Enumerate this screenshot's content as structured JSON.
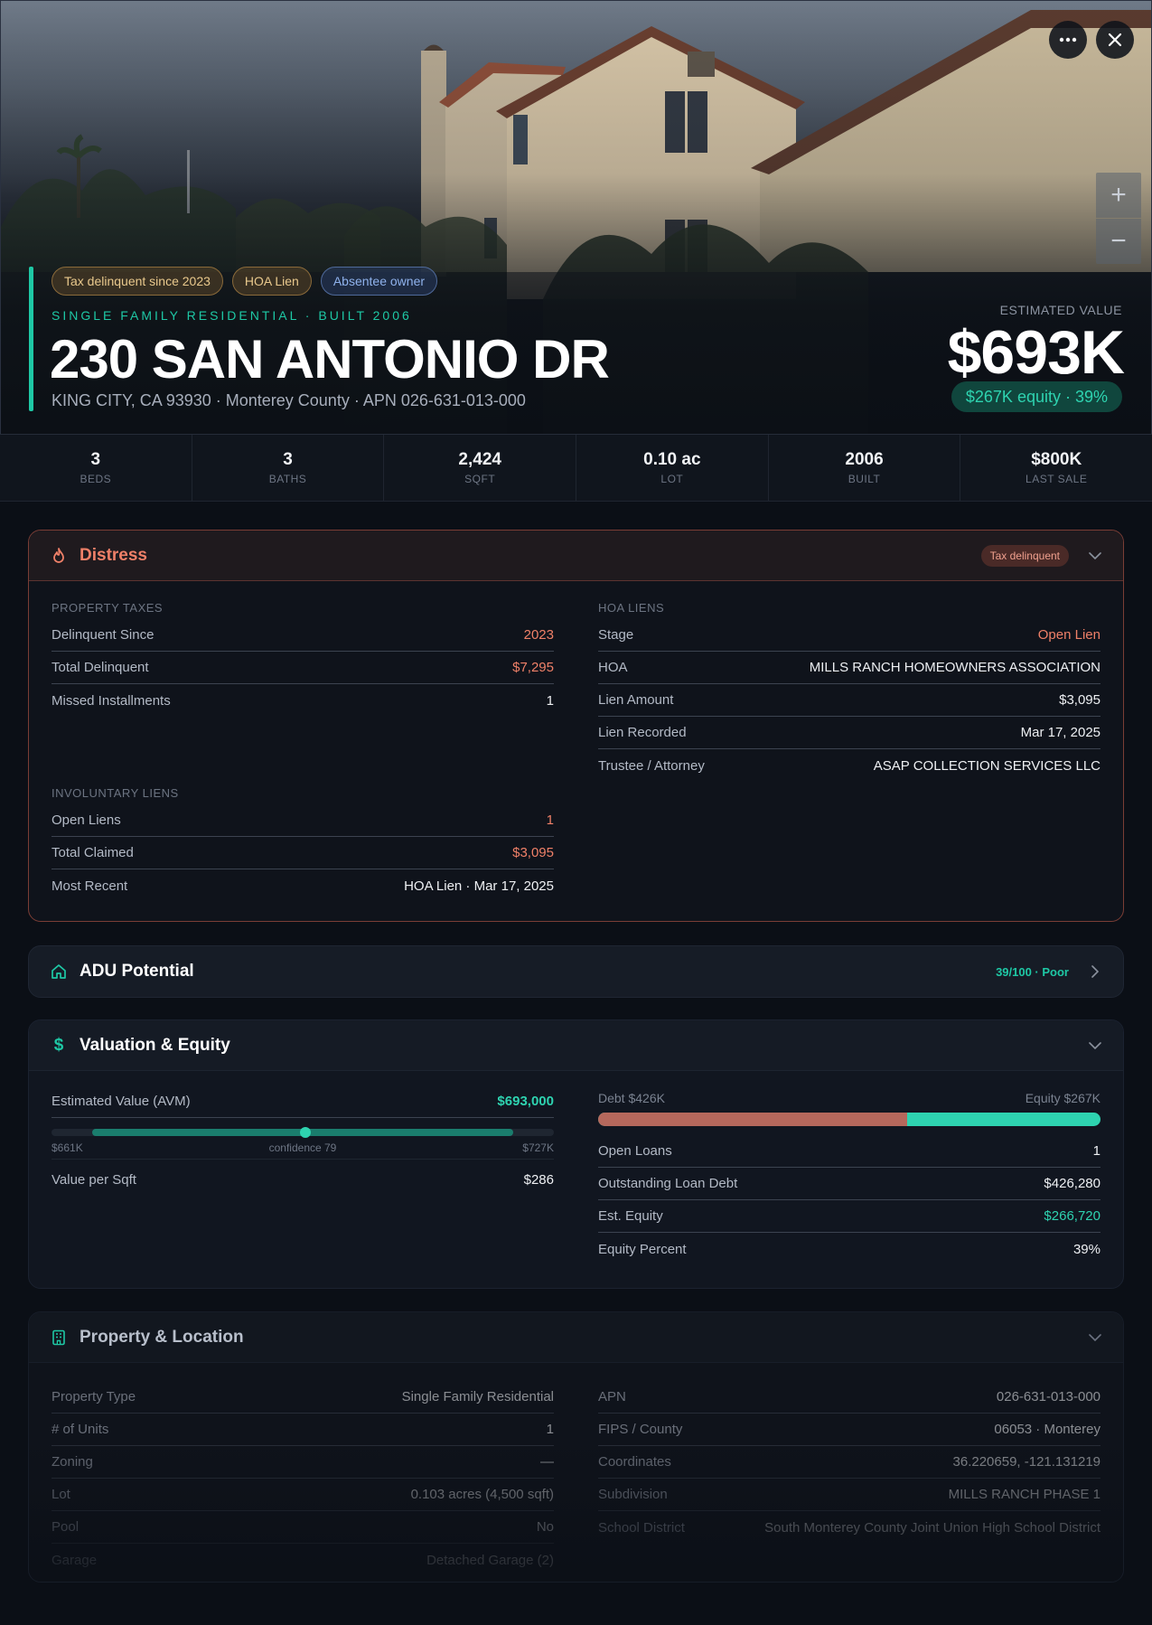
{
  "hero": {
    "tags": {
      "tax": "Tax delinquent since 2023",
      "hoa": "HOA Lien",
      "absentee": "Absentee owner"
    },
    "subtype": "SINGLE FAMILY RESIDENTIAL · BUILT 2006",
    "address": "230 SAN ANTONIO DR",
    "location": "KING CITY, CA 93930 · Monterey County · APN 026-631-013-000",
    "estimated_label": "ESTIMATED VALUE",
    "estimated_value": "$693K",
    "equity_pill": "$267K equity · 39%",
    "zoom_in": "+",
    "zoom_out": "−"
  },
  "stats": [
    {
      "value": "3",
      "label": "BEDS"
    },
    {
      "value": "3",
      "label": "BATHS"
    },
    {
      "value": "2,424",
      "label": "SQFT"
    },
    {
      "value": "0.10 ac",
      "label": "LOT"
    },
    {
      "value": "2006",
      "label": "BUILT"
    },
    {
      "value": "$800K",
      "label": "LAST SALE"
    }
  ],
  "distress": {
    "title": "Distress",
    "badge": "Tax delinquent",
    "property_taxes": {
      "label": "PROPERTY TAXES",
      "rows": [
        {
          "k": "Delinquent Since",
          "v": "2023"
        },
        {
          "k": "Total Delinquent",
          "v": "$7,295"
        },
        {
          "k": "Missed Installments",
          "v": "1"
        }
      ]
    },
    "involuntary_liens": {
      "label": "INVOLUNTARY LIENS",
      "rows": [
        {
          "k": "Open Liens",
          "v": "1"
        },
        {
          "k": "Total Claimed",
          "v": "$3,095"
        },
        {
          "k": "Most Recent",
          "v": "HOA Lien · Mar 17, 2025"
        }
      ]
    },
    "hoa_liens": {
      "label": "HOA LIENS",
      "rows": [
        {
          "k": "Stage",
          "v": "Open Lien"
        },
        {
          "k": "HOA",
          "v": "MILLS RANCH HOMEOWNERS ASSOCIATION"
        },
        {
          "k": "Lien Amount",
          "v": "$3,095"
        },
        {
          "k": "Lien Recorded",
          "v": "Mar 17, 2025"
        },
        {
          "k": "Trustee / Attorney",
          "v": "ASAP COLLECTION SERVICES LLC"
        }
      ]
    }
  },
  "adu": {
    "title": "ADU Potential",
    "score": "39/100 · Poor"
  },
  "valuation": {
    "title": "Valuation & Equity",
    "avm_label": "Estimated Value (AVM)",
    "avm_value": "$693,000",
    "avm_low": "$661K",
    "avm_confidence": "confidence 79",
    "avm_high": "$727K",
    "value_per_sqft_label": "Value per Sqft",
    "value_per_sqft": "$286",
    "debt_label": "Debt $426K",
    "equity_label": "Equity $267K",
    "debt_fraction": 0.615,
    "rows": [
      {
        "k": "Open Loans",
        "v": "1"
      },
      {
        "k": "Outstanding Loan Debt",
        "v": "$426,280"
      },
      {
        "k": "Est. Equity",
        "v": "$266,720"
      },
      {
        "k": "Equity Percent",
        "v": "39%"
      }
    ]
  },
  "property": {
    "title": "Property & Location",
    "left_rows": [
      {
        "k": "Property Type",
        "v": "Single Family Residential"
      },
      {
        "k": "# of Units",
        "v": "1"
      },
      {
        "k": "Zoning",
        "v": "—"
      },
      {
        "k": "Lot",
        "v": "0.103 acres (4,500 sqft)"
      },
      {
        "k": "Pool",
        "v": "No"
      },
      {
        "k": "Garage",
        "v": "Detached Garage (2)"
      }
    ],
    "right_rows": [
      {
        "k": "APN",
        "v": "026-631-013-000"
      },
      {
        "k": "FIPS / County",
        "v": "06053 · Monterey"
      },
      {
        "k": "Coordinates",
        "v": "36.220659, -121.131219"
      },
      {
        "k": "Subdivision",
        "v": "MILLS RANCH PHASE 1"
      },
      {
        "k": "School District",
        "v": "South Monterey County Joint Union High School District"
      }
    ]
  },
  "colors": {
    "accent": "#1ec8a5",
    "distress": "#ef8068",
    "debt": "#b5685c"
  }
}
